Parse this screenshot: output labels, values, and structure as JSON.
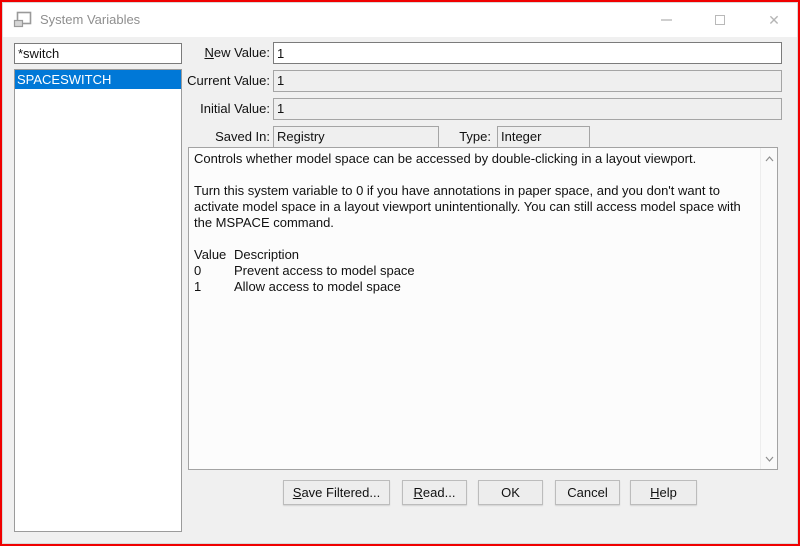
{
  "window": {
    "title": "System Variables",
    "icons": {
      "app_icon": "form-window",
      "minimize": "thin-dash",
      "maximize": "hollow-square",
      "close": "✕"
    }
  },
  "filter_panel": {
    "filter_value": "*switch",
    "list": [
      {
        "name": "SPACESWITCH",
        "selected": true
      }
    ]
  },
  "fields": {
    "new_value": {
      "label_mnemonic": "N",
      "label_rest": "ew Value:",
      "value": "1"
    },
    "current_value": {
      "label": "Current Value:",
      "value": "1"
    },
    "initial_value": {
      "label": "Initial Value:",
      "value": "1"
    },
    "saved_in": {
      "label": "Saved In:",
      "value": "Registry"
    },
    "type": {
      "label": "Type:",
      "value": "Integer"
    }
  },
  "description": {
    "paragraphs": [
      "Controls whether model space can be accessed by double-clicking in a layout viewport.",
      "Turn this system variable to 0 if you have annotations in paper space, and you don't want to activate model space in a layout viewport unintentionally. You can still access model space with the MSPACE command."
    ],
    "table": {
      "header": [
        "Value",
        "Description"
      ],
      "rows": [
        [
          "0",
          "Prevent access to model space"
        ],
        [
          "1",
          "Allow access to model space"
        ]
      ]
    }
  },
  "buttons": [
    {
      "mnemonic": "S",
      "rest": "ave Filtered..."
    },
    {
      "mnemonic": "R",
      "rest": "ead..."
    },
    {
      "mnemonic": "",
      "rest": "OK"
    },
    {
      "mnemonic": "",
      "rest": "Cancel"
    },
    {
      "mnemonic": "H",
      "rest": "elp"
    }
  ],
  "colors": {
    "selection_blue": "#0078d7",
    "annotation_border_red": "#f00000",
    "dialog_background": "#f0f0f0",
    "titlebar_background": "#ffffff"
  }
}
